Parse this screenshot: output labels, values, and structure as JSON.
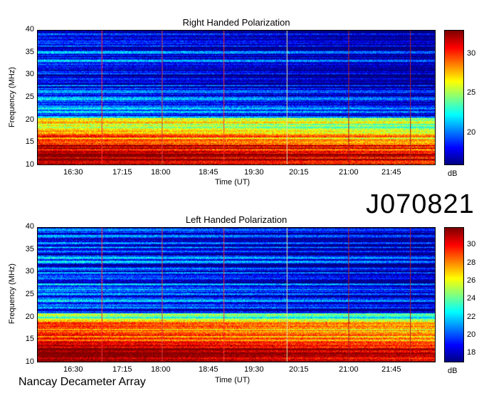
{
  "observation_id": "J070821",
  "footer": "Nancay Decameter Array",
  "colors": {
    "min": "#00008f",
    "max": "#8f0000"
  },
  "chart_data": [
    {
      "type": "heatmap",
      "title": "Right Handed Polarization",
      "xlabel": "Time (UT)",
      "ylabel": "Frequency (MHz)",
      "x_ticks": [
        "16:30",
        "17:15",
        "18:00",
        "18:45",
        "19:30",
        "20:15",
        "21:00",
        "21:45"
      ],
      "y_ticks": [
        10,
        15,
        20,
        25,
        30,
        35,
        40
      ],
      "ylim": [
        10,
        40
      ],
      "colorbar": {
        "label": "dB",
        "ticks": [
          20,
          25,
          30
        ],
        "range": [
          16,
          33
        ]
      }
    },
    {
      "type": "heatmap",
      "title": "Left Handed Polarization",
      "xlabel": "Time (UT)",
      "ylabel": "Frequency (MHz)",
      "x_ticks": [
        "16:30",
        "17:15",
        "18:00",
        "18:45",
        "19:30",
        "20:15",
        "21:00",
        "21:45"
      ],
      "y_ticks": [
        10,
        15,
        20,
        25,
        30,
        35,
        40
      ],
      "ylim": [
        10,
        40
      ],
      "colorbar": {
        "label": "dB",
        "ticks": [
          18,
          20,
          22,
          24,
          26,
          28,
          30
        ],
        "range": [
          17,
          32
        ]
      }
    }
  ]
}
